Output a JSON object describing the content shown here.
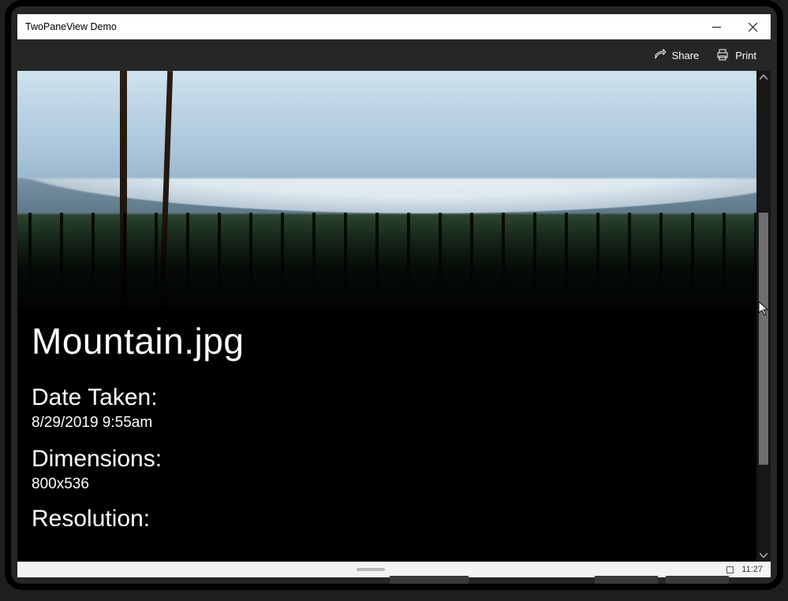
{
  "window": {
    "title": "TwoPaneView Demo"
  },
  "commandbar": {
    "share_label": "Share",
    "print_label": "Print"
  },
  "details": {
    "filename": "Mountain.jpg",
    "date_taken_label": "Date Taken:",
    "date_taken_value": "8/29/2019 9:55am",
    "dimensions_label": "Dimensions:",
    "dimensions_value": "800x536",
    "resolution_label": "Resolution:"
  },
  "statusbar": {
    "clock": "11:27"
  }
}
